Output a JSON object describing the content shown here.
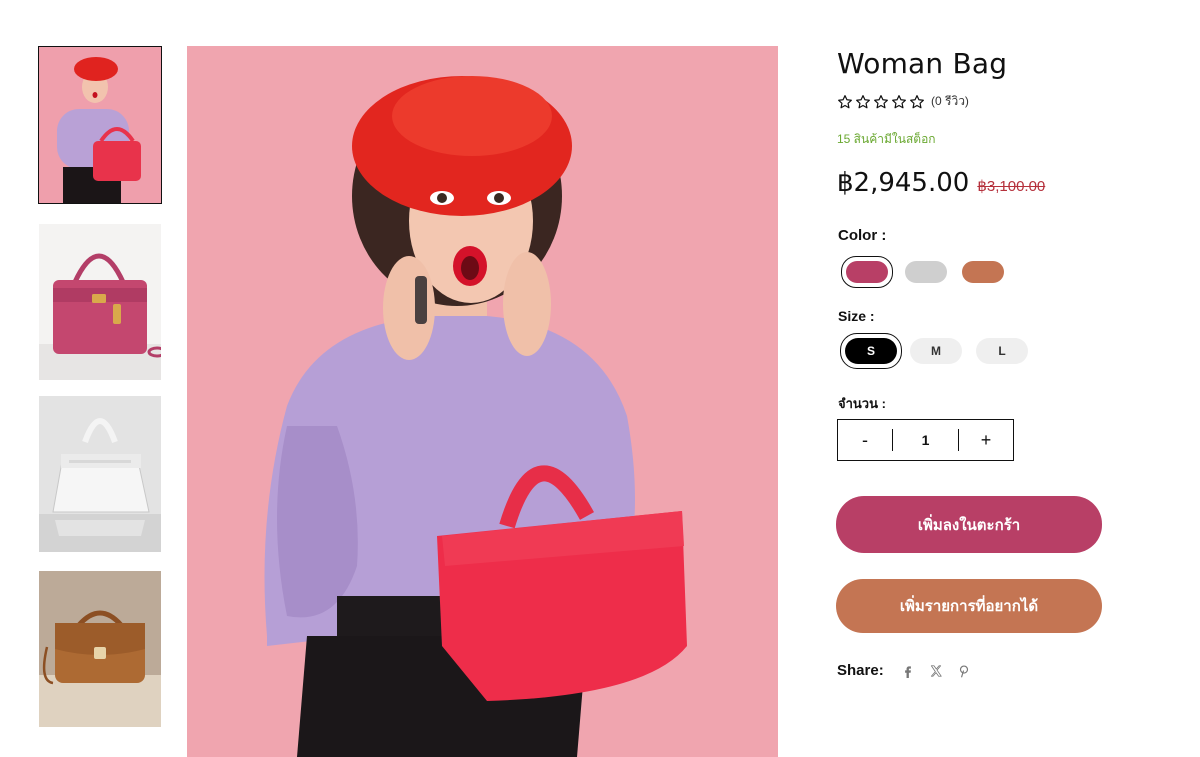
{
  "product": {
    "title": "Woman Bag",
    "rating_stars": 0,
    "review_count": "(0 รีวิว)",
    "stock": "15 สินค้ามีในสต็อก",
    "price": "฿2,945.00",
    "old_price": "฿3,100.00"
  },
  "color": {
    "label": "Color  :",
    "swatches": [
      {
        "name": "pink",
        "hex": "#b83f66",
        "selected": true
      },
      {
        "name": "gray",
        "hex": "#cfcfcf",
        "selected": false
      },
      {
        "name": "tan",
        "hex": "#c47553",
        "selected": false
      }
    ]
  },
  "size": {
    "label": "Size  :",
    "options": [
      "S",
      "M",
      "L"
    ],
    "selected": "S"
  },
  "quantity": {
    "label": "จำนวน :",
    "minus": "-",
    "value": "1",
    "plus": "+"
  },
  "actions": {
    "add_to_cart": "เพิ่มลงในตะกร้า",
    "add_to_wishlist": "เพิ่มรายการที่อยากได้"
  },
  "share": {
    "label": "Share:",
    "icons": [
      "facebook-icon",
      "x-icon",
      "pinterest-icon"
    ]
  },
  "colors": {
    "accent_pink": "#b83f66",
    "accent_tan": "#c47553",
    "stock_green": "#6aa831",
    "old_price_red": "#b5313c"
  }
}
